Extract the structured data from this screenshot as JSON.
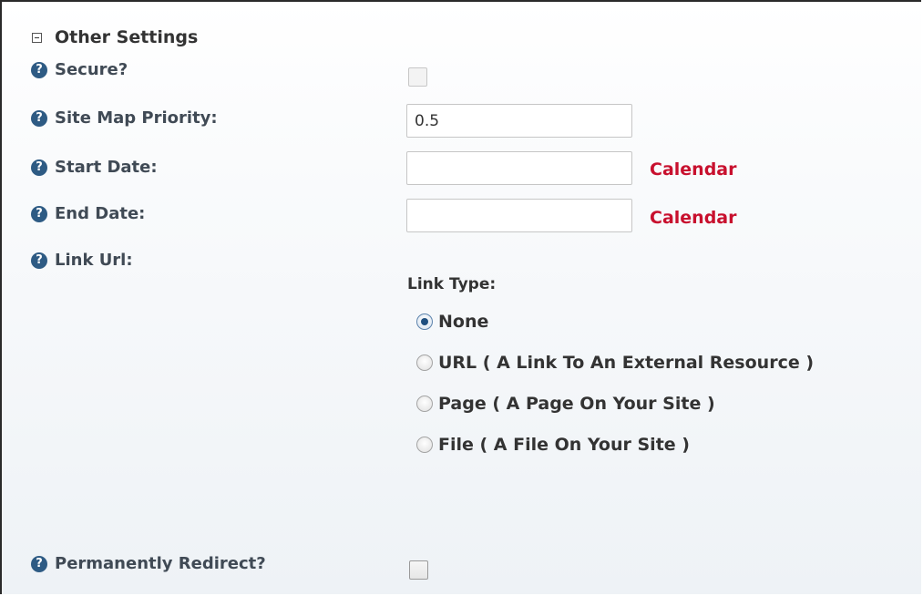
{
  "section": {
    "title": "Other Settings"
  },
  "help_icon_glyph": "?",
  "fields": {
    "secure_label": "Secure?",
    "priority_label": "Site Map Priority:",
    "priority_value": "0.5",
    "start_label": "Start Date:",
    "start_value": "",
    "end_label": "End Date:",
    "end_value": "",
    "calendar_label": "Calendar",
    "link_url_label": "Link Url:",
    "redirect_label": "Permanently Redirect?"
  },
  "link_type": {
    "label": "Link Type:",
    "options": [
      {
        "label": "None",
        "checked": true
      },
      {
        "label": "URL ( A Link To An External Resource )",
        "checked": false
      },
      {
        "label": "Page ( A Page On Your Site )",
        "checked": false
      },
      {
        "label": "File ( A File On Your Site )",
        "checked": false
      }
    ]
  },
  "colors": {
    "help_icon": "#2e5b84",
    "calendar_link": "#c8102e",
    "label_text": "#404a55"
  }
}
